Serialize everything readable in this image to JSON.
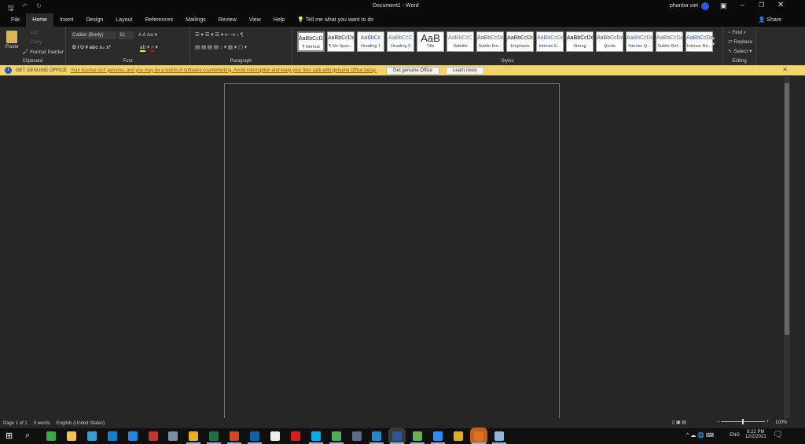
{
  "title": {
    "document": "Document1  -  Word",
    "user": "phanba viet",
    "share": "Share"
  },
  "tabs": [
    "File",
    "Home",
    "Insert",
    "Design",
    "Layout",
    "References",
    "Mailings",
    "Review",
    "View",
    "Help"
  ],
  "tell_me": "Tell me what you want to do",
  "clipboard": {
    "paste": "Paste",
    "cut": "Cut",
    "copy": "Copy",
    "format_painter": "Format Painter",
    "label": "Clipboard"
  },
  "font": {
    "name": "Calibri (Body)",
    "size": "11",
    "label": "Font"
  },
  "paragraph": {
    "label": "Paragraph"
  },
  "styles": {
    "label": "Styles",
    "items": [
      {
        "preview": "AaBbCcDc",
        "name": "¶ Normal",
        "color": "#222"
      },
      {
        "preview": "AaBbCcDc",
        "name": "¶ No Spac...",
        "color": "#222"
      },
      {
        "preview": "AaBbCc",
        "name": "Heading 1",
        "color": "#2f5597"
      },
      {
        "preview": "AaBbCcC",
        "name": "Heading 2",
        "color": "#4472c4"
      },
      {
        "preview": "AaB",
        "name": "Title",
        "color": "#222"
      },
      {
        "preview": "AaBbCcC",
        "name": "Subtitle",
        "color": "#777"
      },
      {
        "preview": "AaBbCcDc",
        "name": "Subtle Em...",
        "color": "#555"
      },
      {
        "preview": "AaBbCcDc",
        "name": "Emphasis",
        "color": "#222"
      },
      {
        "preview": "AaBbCcDc",
        "name": "Intense E...",
        "color": "#4472c4"
      },
      {
        "preview": "AaBbCcDc",
        "name": "Strong",
        "color": "#000"
      },
      {
        "preview": "AaBbCcDc",
        "name": "Quote",
        "color": "#555"
      },
      {
        "preview": "AaBbCcDc",
        "name": "Intense Q...",
        "color": "#4472c4"
      },
      {
        "preview": "AaBbCcDc",
        "name": "Subtle Ref...",
        "color": "#666"
      },
      {
        "preview": "AaBbCcDc",
        "name": "Intense Re...",
        "color": "#2f5597"
      }
    ]
  },
  "editing": {
    "find": "Find",
    "replace": "Replace",
    "select": "Select",
    "label": "Editing"
  },
  "banner": {
    "title": "GET GENUINE OFFICE",
    "message": "Your license isn't genuine, and you may be a victim of software counterfeiting. Avoid interruption and keep your files safe with genuine Office today.",
    "get_button": "Get genuine Office",
    "learn_button": "Learn more"
  },
  "status": {
    "page": "Page 1 of 1",
    "words": "0 words",
    "language": "English (United States)",
    "zoom": "100%"
  },
  "tray": {
    "lang": "ENG",
    "time": "8:22 PM",
    "date": "12/2/2021"
  },
  "taskbar_icons": [
    {
      "name": "camtasia",
      "color": "#3aa845"
    },
    {
      "name": "file-explorer",
      "color": "#f2c14e"
    },
    {
      "name": "edge",
      "color": "#2f9fd8"
    },
    {
      "name": "store",
      "color": "#0a84d6"
    },
    {
      "name": "mail",
      "color": "#1e88e5"
    },
    {
      "name": "app",
      "color": "#c0392b"
    },
    {
      "name": "app2",
      "color": "#7a8fa6"
    },
    {
      "name": "chrome",
      "color": "#e8b21f"
    },
    {
      "name": "excel",
      "color": "#1e7145"
    },
    {
      "name": "powerpoint",
      "color": "#d24726"
    },
    {
      "name": "outlook",
      "color": "#0a64ad"
    },
    {
      "name": "m-app",
      "color": "#eeeeee"
    },
    {
      "name": "recorder",
      "color": "#d61e1e"
    },
    {
      "name": "skype",
      "color": "#00aff0"
    },
    {
      "name": "chrome2",
      "color": "#4caf50"
    },
    {
      "name": "app3",
      "color": "#5a6e8c"
    },
    {
      "name": "vscode",
      "color": "#2489ca"
    },
    {
      "name": "word",
      "color": "#2b579a"
    },
    {
      "name": "app4",
      "color": "#6ab04c"
    },
    {
      "name": "zoom",
      "color": "#2d8cff"
    },
    {
      "name": "app5",
      "color": "#e0b020"
    },
    {
      "name": "app6",
      "color": "#e07020"
    },
    {
      "name": "app7",
      "color": "#8fb8d8"
    }
  ]
}
